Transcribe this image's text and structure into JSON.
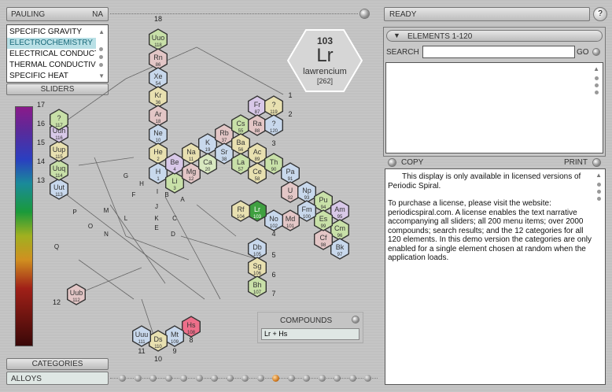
{
  "top": {
    "scale_name": "PAULING",
    "scale_code": "NA",
    "status": "READY",
    "help_label": "?"
  },
  "sliders": {
    "items": [
      "SPECIFIC GRAVITY",
      "ELECTROCHEMISTRY",
      "ELECTRICAL CONDUCT",
      "THERMAL CONDUCTIV",
      "SPECIFIC HEAT"
    ],
    "selected_index": 1,
    "label": "SLIDERS"
  },
  "categories": {
    "label": "CATEGORIES",
    "value": "ALLOYS"
  },
  "element_card": {
    "number": "103",
    "symbol": "Lr",
    "name": "lawrencium",
    "mass": "[262]"
  },
  "elements_panel": {
    "header": "ELEMENTS 1-120",
    "search_label": "SEARCH",
    "search_value": "",
    "go_label": "GO"
  },
  "copy_print": {
    "copy_label": "COPY",
    "print_label": "PRINT"
  },
  "narrative": {
    "p1": "This display is only available in licensed versions of Periodic Spiral.",
    "p2": "To purchase a license, please visit the website: periodicspiral.com. A license enables the text narrative accompanying all sliders; all 200 menu items; over 2000 compounds; search results; and the 12 categories for all 120 elements. In this demo version the categories are only enabled for a single element chosen at random when the application loads."
  },
  "compounds": {
    "label": "COMPOUNDS",
    "value": "Lr + Hs"
  },
  "spiral": {
    "elements": [
      {
        "s": "Uuo",
        "n": "118",
        "c": "#c8e0a8"
      },
      {
        "s": "Rn",
        "n": "86",
        "c": "#e3c6c6"
      },
      {
        "s": "Xe",
        "n": "54",
        "c": "#c8d8ec"
      },
      {
        "s": "Kr",
        "n": "36",
        "c": "#e8e0b0"
      },
      {
        "s": "Ar",
        "n": "18",
        "c": "#e3c6c6"
      },
      {
        "s": "Ne",
        "n": "10",
        "c": "#c8d8ec"
      },
      {
        "s": "He",
        "n": "2",
        "c": "#e8e0b0"
      },
      {
        "s": "H",
        "n": "1",
        "c": "#c8d8ec"
      },
      {
        "s": "Li",
        "n": "3",
        "c": "#c8e0a8"
      },
      {
        "s": "Be",
        "n": "4",
        "c": "#d8c8e8"
      },
      {
        "s": "Na",
        "n": "11",
        "c": "#e8e0b0"
      },
      {
        "s": "Mg",
        "n": "12",
        "c": "#e3c6c6"
      },
      {
        "s": "K",
        "n": "19",
        "c": "#c8d8ec"
      },
      {
        "s": "Ca",
        "n": "20",
        "c": "#d8e8c0"
      },
      {
        "s": "Rb",
        "n": "37",
        "c": "#e3c6c6"
      },
      {
        "s": "Sr",
        "n": "38",
        "c": "#c8d8ec"
      },
      {
        "s": "Cs",
        "n": "55",
        "c": "#c8e0a8"
      },
      {
        "s": "Ba",
        "n": "56",
        "c": "#e8e0b0"
      },
      {
        "s": "Fr",
        "n": "87",
        "c": "#d8c8e8"
      },
      {
        "s": "Ra",
        "n": "88",
        "c": "#e3c6c6"
      },
      {
        "s": "?",
        "n": "119",
        "c": "#e8e0b0"
      },
      {
        "s": "?",
        "n": "120",
        "c": "#c8d8ec"
      },
      {
        "s": "Ac",
        "n": "89",
        "c": "#e8e0b0"
      },
      {
        "s": "La",
        "n": "57",
        "c": "#c8e0a8"
      },
      {
        "s": "Ce",
        "n": "58",
        "c": "#e8e0b0"
      },
      {
        "s": "Th",
        "n": "90",
        "c": "#c8e0a8"
      },
      {
        "s": "Pa",
        "n": "91",
        "c": "#c8d8ec"
      },
      {
        "s": "U",
        "n": "92",
        "c": "#e3c6c6"
      },
      {
        "s": "Np",
        "n": "93",
        "c": "#c8d8ec"
      },
      {
        "s": "Pu",
        "n": "94",
        "c": "#c8e0a8"
      },
      {
        "s": "Am",
        "n": "95",
        "c": "#d8c8e8"
      },
      {
        "s": "Cm",
        "n": "96",
        "c": "#c8e0a8"
      },
      {
        "s": "Bk",
        "n": "97",
        "c": "#c8d8ec"
      },
      {
        "s": "Cf",
        "n": "98",
        "c": "#e3c6c6"
      },
      {
        "s": "Es",
        "n": "99",
        "c": "#c8e0a8"
      },
      {
        "s": "Fm",
        "n": "100",
        "c": "#c8d8ec"
      },
      {
        "s": "Md",
        "n": "101",
        "c": "#e3c6c6"
      },
      {
        "s": "No",
        "n": "102",
        "c": "#c8d8ec"
      },
      {
        "s": "Lr",
        "n": "103",
        "c": "#3fa040"
      },
      {
        "s": "Rf",
        "n": "104",
        "c": "#e8e0b0"
      },
      {
        "s": "Db",
        "n": "105",
        "c": "#c8d8ec"
      },
      {
        "s": "Sg",
        "n": "106",
        "c": "#e8e0b0"
      },
      {
        "s": "Bh",
        "n": "107",
        "c": "#c8e0a8"
      },
      {
        "s": "Hs",
        "n": "108",
        "c": "#ee6f8a"
      },
      {
        "s": "Mt",
        "n": "109",
        "c": "#c8d8ec"
      },
      {
        "s": "Ds",
        "n": "110",
        "c": "#e8e0b0"
      },
      {
        "s": "Uuu",
        "n": "111",
        "c": "#c8d8ec"
      },
      {
        "s": "Uub",
        "n": "112",
        "c": "#e3c6c6"
      },
      {
        "s": "Uut",
        "n": "113",
        "c": "#c8d8ec"
      },
      {
        "s": "Uuq",
        "n": "114",
        "c": "#c8e0a8"
      },
      {
        "s": "Uup",
        "n": "115",
        "c": "#e8e0b0"
      },
      {
        "s": "Uuh",
        "n": "116",
        "c": "#d8c8e8"
      },
      {
        "s": "?",
        "n": "117",
        "c": "#c8e0a8"
      }
    ],
    "group_labels": [
      "1",
      "2",
      "3",
      "4",
      "5",
      "6",
      "7",
      "8",
      "9",
      "10",
      "11",
      "12",
      "13",
      "14",
      "15",
      "16",
      "17",
      "18"
    ],
    "subgroup_labels": [
      "A",
      "B",
      "C",
      "D",
      "E",
      "F",
      "G",
      "H",
      "I",
      "J",
      "K",
      "L",
      "M",
      "N",
      "O",
      "P",
      "Q"
    ]
  },
  "colors": {
    "lr_highlight": "#3fa040",
    "hs_highlight": "#ee6f8a",
    "selected_list": "#b9e0e6"
  }
}
